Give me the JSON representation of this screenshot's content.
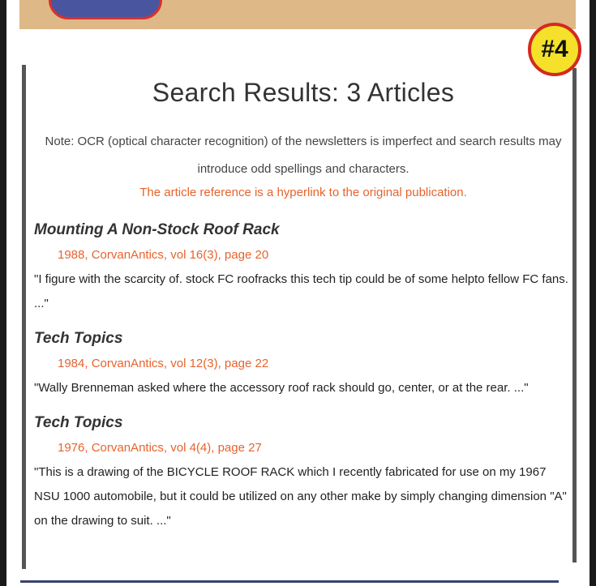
{
  "badge": {
    "label": "#4"
  },
  "search": {
    "title": "Search Results: 3 Articles",
    "note": "Note: OCR (optical character recognition) of the newsletters is imperfect and search results may introduce odd spellings and characters.",
    "hyperlink_note": "The article reference is a hyperlink to the original publication."
  },
  "articles": [
    {
      "title": "Mounting A Non-Stock Roof Rack",
      "reference": "1988, CorvanAntics, vol 16(3), page 20",
      "excerpt": "\"I figure with the scarcity of. stock FC roofracks this tech tip could be of some helpto fellow FC fans. ...\""
    },
    {
      "title": "Tech Topics",
      "reference": "1984, CorvanAntics, vol 12(3), page 22",
      "excerpt": "\"Wally Brenneman asked where the accessory roof rack should go, center, or at the rear. ...\""
    },
    {
      "title": "Tech Topics",
      "reference": "1976, CorvanAntics, vol 4(4), page 27",
      "excerpt": "\"This is a drawing of the BICYCLE ROOF RACK which I recently fabricated for use on my 1967 NSU 1000 automobile, but it could be utilized on any other make by simply changing dimension \"A\" on the drawing to suit. ...\""
    }
  ],
  "colors": {
    "link": "#e8632c",
    "banner": "#deb887",
    "badge_fill": "#f5e12a",
    "badge_border": "#d42a1e"
  }
}
